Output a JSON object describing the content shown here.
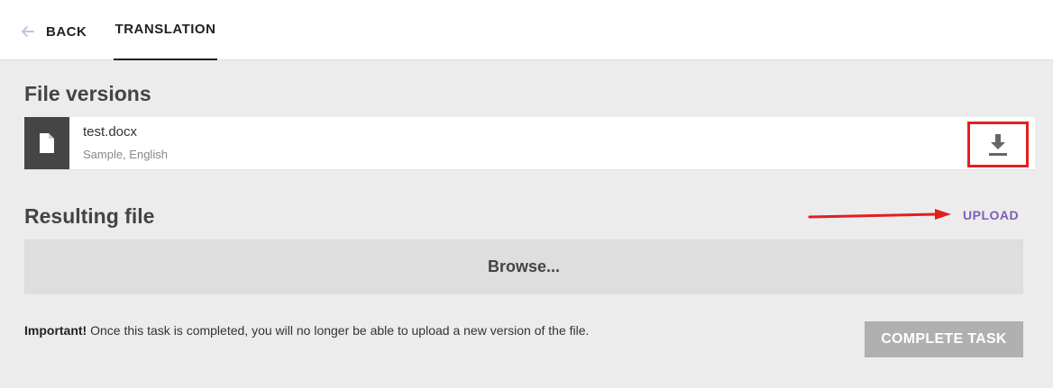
{
  "header": {
    "back_label": "BACK",
    "tab_label": "TRANSLATION"
  },
  "file_versions": {
    "title": "File versions",
    "file": {
      "name": "test.docx",
      "meta": "Sample, English",
      "icon": "file-icon",
      "download_icon": "download-icon"
    }
  },
  "resulting_file": {
    "title": "Resulting file",
    "upload_label": "UPLOAD",
    "browse_label": "Browse..."
  },
  "notice": {
    "strong": "Important!",
    "text": " Once this task is completed, you will no longer be able to upload a new version of the file."
  },
  "complete_label": "COMPLETE TASK",
  "colors": {
    "accent": "#7c5fb9",
    "highlight": "#e41e1e",
    "disabled_button": "#b0b0b0"
  }
}
